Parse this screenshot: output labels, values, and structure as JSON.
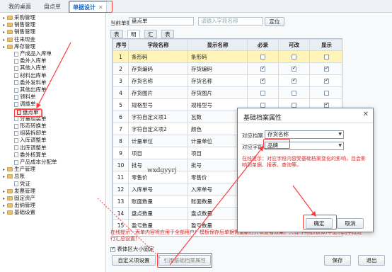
{
  "tabs": [
    {
      "label": "我的桌面"
    },
    {
      "label": "盘点单"
    },
    {
      "label": "单据设计"
    }
  ],
  "tree": [
    {
      "label": "采购管理",
      "type": "folder"
    },
    {
      "label": "销售管理",
      "type": "folder"
    },
    {
      "label": "销售管理",
      "type": "folder"
    },
    {
      "label": "往来现金",
      "type": "folder"
    },
    {
      "label": "库存管理",
      "type": "folder"
    },
    {
      "label": "产成品入库单",
      "type": "leaf"
    },
    {
      "label": "委外入库单",
      "type": "leaf"
    },
    {
      "label": "其他入库单",
      "type": "leaf"
    },
    {
      "label": "材料出库单",
      "type": "leaf"
    },
    {
      "label": "委外发料单",
      "type": "leaf"
    },
    {
      "label": "其他出库单",
      "type": "leaf"
    },
    {
      "label": "领料单",
      "type": "leaf"
    },
    {
      "label": "调拨单",
      "type": "leaf"
    },
    {
      "label": "盘点单",
      "type": "leaf",
      "selected": true
    },
    {
      "label": "分量组装单",
      "type": "leaf"
    },
    {
      "label": "形态转换单",
      "type": "leaf"
    },
    {
      "label": "组装拆卸单",
      "type": "leaf"
    },
    {
      "label": "入库调整单",
      "type": "leaf"
    },
    {
      "label": "出库调整单",
      "type": "leaf"
    },
    {
      "label": "委外核算单",
      "type": "leaf"
    },
    {
      "label": "产品成本分配单",
      "type": "leaf"
    },
    {
      "label": "生产管理",
      "type": "folder"
    },
    {
      "label": "总账",
      "type": "folder"
    },
    {
      "label": "凭证",
      "type": "leaf"
    },
    {
      "label": "发票管理",
      "type": "folder"
    },
    {
      "label": "固定资产",
      "type": "folder"
    },
    {
      "label": "出纳管理",
      "type": "folder"
    },
    {
      "label": "基础设置",
      "type": "folder"
    }
  ],
  "form": {
    "current_doc_label": "当前单据",
    "current_doc_value": "盘点单",
    "search_placeholder": "请输入字段名称",
    "locate_button": "定位",
    "subtabs": [
      "表头",
      "明细",
      "汇总",
      "表尾"
    ]
  },
  "grid": {
    "headers": [
      "序号",
      "字段名称",
      "显示名称",
      "必录",
      "可改",
      "显示"
    ],
    "rows": [
      {
        "no": "1",
        "field": "条形码",
        "display": "条形码",
        "req": false,
        "edit": false,
        "show": false
      },
      {
        "no": "2",
        "field": "存货编码",
        "display": "存货编码",
        "req": true,
        "edit": true,
        "show": true
      },
      {
        "no": "3",
        "field": "存货名称",
        "display": "存货名称",
        "req": true,
        "edit": true,
        "show": true
      },
      {
        "no": "4",
        "field": "存货图片",
        "display": "存货图片",
        "req": false,
        "edit": false,
        "show": false
      },
      {
        "no": "5",
        "field": "规格型号",
        "display": "规格型号",
        "req": false,
        "edit": false,
        "show": true
      },
      {
        "no": "6",
        "field": "字符自定义项1",
        "display": "瓦数",
        "req": false,
        "edit": true,
        "show": true
      },
      {
        "no": "7",
        "field": "字符自定义项2",
        "display": "颜色",
        "req": false,
        "edit": true,
        "show": true
      },
      {
        "no": "8",
        "field": "计量单位",
        "display": "计量单位",
        "req": false,
        "edit": false,
        "show": true
      },
      {
        "no": "9",
        "field": "项目",
        "display": "项目",
        "req": false,
        "edit": false,
        "show": true
      },
      {
        "no": "10",
        "field": "批号",
        "display": "批号",
        "req": false,
        "edit": false,
        "show": true
      },
      {
        "no": "11",
        "field": "零售价",
        "display": "零售价",
        "req": false,
        "edit": false,
        "show": true
      },
      {
        "no": "12",
        "field": "入库单号",
        "display": "入库单号",
        "req": false,
        "edit": false,
        "show": true
      },
      {
        "no": "13",
        "field": "账面数量",
        "display": "账面数量",
        "req": false,
        "edit": false,
        "show": true
      },
      {
        "no": "14",
        "field": "盘点数量",
        "display": "盘点数量",
        "req": false,
        "edit": false,
        "show": true
      },
      {
        "no": "15",
        "field": "盈亏数量",
        "display": "盈亏数量",
        "req": false,
        "edit": false,
        "show": true
      }
    ]
  },
  "hint_text": "在线提示：表单内容将应用于全部用户！模板保存后单据需重新打开以查看效果。只有所明细(表体)中显示的字段进行汇总设置！",
  "table_size_label": "表体区大小固定",
  "buttons": {
    "custom": "自定义项设置",
    "cite": "引用基础档案属性",
    "save": "保存",
    "exit": "退出"
  },
  "watermark": "wxdgyyrj",
  "dialog": {
    "title": "基础档案属性",
    "close": "✕",
    "archive_label": "对应档案",
    "archive_value": "存货名称",
    "field_label": "对应字段",
    "field_value": "品牌",
    "note": "在线提示：对应字段内容受基础档案变化的影响，且会影响到单据、报表、查询等。",
    "ok": "确定",
    "cancel": "取消"
  },
  "colors": {
    "accent": "#1565c0",
    "highlight": "#ff3b3b"
  }
}
